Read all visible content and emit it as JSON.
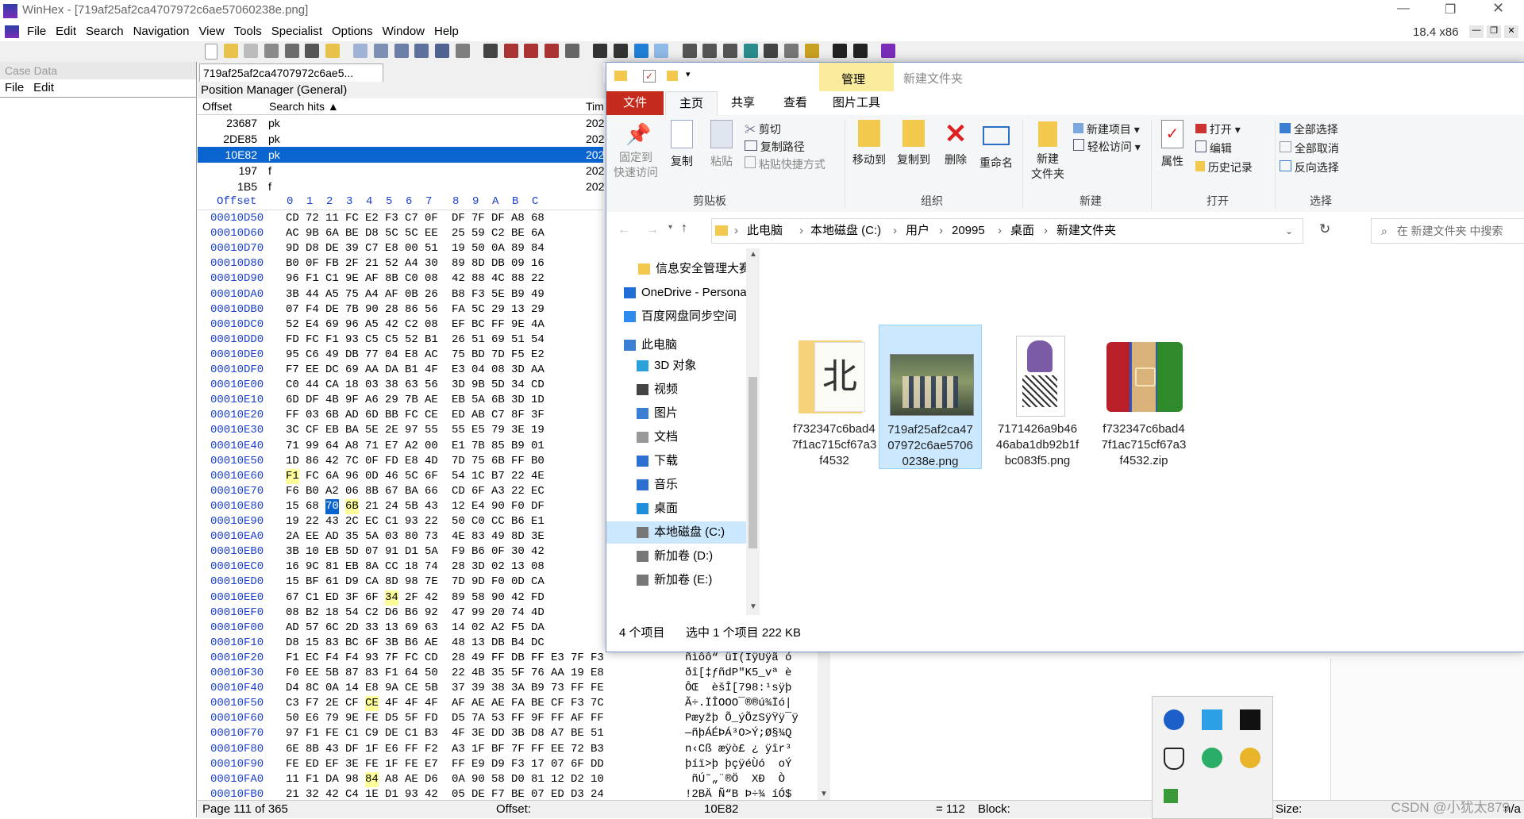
{
  "winhex": {
    "title": "WinHex - [719af25af2ca4707972c6ae57060238e.png]",
    "version": "18.4 x86",
    "menu": [
      "File",
      "Edit",
      "Search",
      "Navigation",
      "View",
      "Tools",
      "Specialist",
      "Options",
      "Window",
      "Help"
    ],
    "case_panel": {
      "title": "Case Data",
      "menu": [
        "File",
        "Edit"
      ]
    },
    "tab_label": "719af25af2ca4707972c6ae5...",
    "position_manager": {
      "title": "Position Manager (General)",
      "columns": [
        "Offset",
        "Search hits ▲",
        "Tim"
      ],
      "rows": [
        {
          "offset": "23687",
          "hit": "pk",
          "time": "202"
        },
        {
          "offset": "2DE85",
          "hit": "pk",
          "time": "202"
        },
        {
          "offset": "10E82",
          "hit": "pk",
          "time": "202"
        },
        {
          "offset": "197",
          "hit": "f",
          "time": "202"
        },
        {
          "offset": "1B5",
          "hit": "f",
          "time": "202"
        }
      ]
    },
    "hex_header": {
      "offset_label": "Offset",
      "cols": [
        "0",
        "1",
        "2",
        "3",
        "4",
        "5",
        "6",
        "7",
        "8",
        "9",
        "A",
        "B",
        "C"
      ]
    },
    "hex_rows": [
      {
        "off": "00010D50",
        "bytes": "CD 72 11 FC E2 F3 C7 0F  DF 7F DF A8 68",
        "text": ""
      },
      {
        "off": "00010D60",
        "bytes": "AC 9B 6A BE D8 5C 5C EE  25 59 C2 BE 6A",
        "text": ""
      },
      {
        "off": "00010D70",
        "bytes": "9D D8 DE 39 C7 E8 00 51  19 50 0A 89 84",
        "text": ""
      },
      {
        "off": "00010D80",
        "bytes": "B0 0F FB 2F 21 52 A4 30  89 8D DB 09 16",
        "text": ""
      },
      {
        "off": "00010D90",
        "bytes": "96 F1 C1 9E AF 8B C0 08  42 88 4C 88 22",
        "text": ""
      },
      {
        "off": "00010DA0",
        "bytes": "3B 44 A5 75 A4 AF 0B 26  B8 F3 5E B9 49",
        "text": ""
      },
      {
        "off": "00010DB0",
        "bytes": "07 F4 DE 7B 90 28 86 56  FA 5C 29 13 29",
        "text": ""
      },
      {
        "off": "00010DC0",
        "bytes": "52 E4 69 96 A5 42 C2 08  EF BC FF 9E 4A",
        "text": ""
      },
      {
        "off": "00010DD0",
        "bytes": "FD FC F1 93 C5 C5 52 B1  26 51 69 51 54",
        "text": ""
      },
      {
        "off": "00010DE0",
        "bytes": "95 C6 49 DB 77 04 E8 AC  75 BD 7D F5 E2",
        "text": ""
      },
      {
        "off": "00010DF0",
        "bytes": "F7 EE DC 69 AA DA B1 4F  E3 04 08 3D AA",
        "text": ""
      },
      {
        "off": "00010E00",
        "bytes": "C0 44 CA 18 03 38 63 56  3D 9B 5D 34 CD",
        "text": ""
      },
      {
        "off": "00010E10",
        "bytes": "6D DF 4B 9F A6 29 7B AE  EB 5A 6B 3D 1D",
        "text": ""
      },
      {
        "off": "00010E20",
        "bytes": "FF 03 6B AD 6D BB FC CE  ED AB C7 8F 3F",
        "text": ""
      },
      {
        "off": "00010E30",
        "bytes": "3C CF EB BA 5E 2E 97 55  55 E5 79 3E 19",
        "text": ""
      },
      {
        "off": "00010E40",
        "bytes": "71 99 64 A8 71 E7 A2 00  E1 7B 85 B9 01",
        "text": ""
      },
      {
        "off": "00010E50",
        "bytes": "1D 86 42 7C 0F FD E8 4D  7D 75 6B FF B0",
        "text": ""
      },
      {
        "off": "00010E60",
        "bytes": "F1 FC 6A 96 0D 46 5C 6F  54 1C B7 22 4E",
        "text": ""
      },
      {
        "off": "00010E70",
        "bytes": "F6 B0 A2 06 8B 67 BA 66  CD 6F A3 22 EC",
        "text": ""
      },
      {
        "off": "00010E80",
        "bytes": "15 68 70 6B 21 24 5B 43  12 E4 90 F0 DF",
        "text": ""
      },
      {
        "off": "00010E90",
        "bytes": "19 22 43 2C EC C1 93 22  50 C0 CC B6 E1",
        "text": ""
      },
      {
        "off": "00010EA0",
        "bytes": "2A EE AD 35 5A 03 80 73  4E 83 49 8D 3E",
        "text": ""
      },
      {
        "off": "00010EB0",
        "bytes": "3B 10 EB 5D 07 91 D1 5A  F9 B6 0F 30 42",
        "text": ""
      },
      {
        "off": "00010EC0",
        "bytes": "16 9C 81 EB 8A CC 18 74  28 3D 02 13 08",
        "text": ""
      },
      {
        "off": "00010ED0",
        "bytes": "15 BF 61 D9 CA 8D 98 7E  7D 9D F0 0D CA",
        "text": ""
      },
      {
        "off": "00010EE0",
        "bytes": "67 C1 ED 3F 6F 34 2F 42  89 58 90 42 FD",
        "text": ""
      },
      {
        "off": "00010EF0",
        "bytes": "08 B2 18 54 C2 D6 B6 92  47 99 20 74 4D",
        "text": ""
      },
      {
        "off": "00010F00",
        "bytes": "AD 57 6C 2D 33 13 69 63  14 02 A2 F5 DA",
        "text": ""
      },
      {
        "off": "00010F10",
        "bytes": "D8 15 83 BC 6F 3B B6 AE  48 13 DB B4 DC",
        "text": ""
      },
      {
        "off": "00010F20",
        "bytes": "F1 EC F4 F4 93 7F FC CD  28 49 FF DB FF E3 7F F3",
        "text": "ñìôô“ üÍ(IÿÛÿã ó"
      },
      {
        "off": "00010F30",
        "bytes": "F0 EE 5B 87 83 F1 64 50  22 4B 35 5F 76 AA 19 E8",
        "text": "ðî[‡ƒñdP\"K5_vª è"
      },
      {
        "off": "00010F40",
        "bytes": "D4 8C 0A 14 E8 9A CE 5B  37 39 38 3A B9 73 FF FE",
        "text": "ÔŒ  èšÎ[798:¹sÿþ"
      },
      {
        "off": "00010F50",
        "bytes": "C3 F7 2E CF CE 4F 4F 4F  AF AE AE FA BE CF F3 7C",
        "text": "Ã÷.ÏÎOOO¯®®ú¾Ïó|"
      },
      {
        "off": "00010F60",
        "bytes": "50 E6 79 9E FE D5 5F FD  D5 7A 53 FF 9F FF AF FF",
        "text": "Pæyžþ Õ_ýÕzSÿŸÿ¯ÿ"
      },
      {
        "off": "00010F70",
        "bytes": "97 F1 FE C1 C9 DE C1 B3  4F 3E DD 3B D8 A7 BE 51",
        "text": "—ñþÁÉÞÁ³O>Ý;Ø§¾Q"
      },
      {
        "off": "00010F80",
        "bytes": "6E 8B 43 DF 1F E6 FF F2  A3 1F BF 7F FF EE 72 B3",
        "text": "n‹Cß æÿò£ ¿ ÿîr³"
      },
      {
        "off": "00010F90",
        "bytes": "FE ED EF 3E FE 1F FE E7  FF E9 D9 F3 17 07 6F DD",
        "text": "þíï>þ þçÿéÙó  oÝ"
      },
      {
        "off": "00010FA0",
        "bytes": "11 F1 DA 98 84 A8 AE D6  0A 90 58 D0 81 12 D2 10",
        "text": " ñÚ˜„¨®Ö  XÐ  Ò "
      },
      {
        "off": "00010FB0",
        "bytes": "21 32 42 C4 1E D1 93 42  05 DE F7 BE 07 ED D3 24",
        "text": "!2BÄ Ñ“B Þ÷¾ íÓ$"
      }
    ],
    "status": {
      "page": "Page 111 of 365",
      "offset_label": "Offset:",
      "offset_value": "10E82",
      "eq": "= 112",
      "block": "Block:",
      "size": "Size:",
      "na": "n/a"
    }
  },
  "explorer": {
    "qa_title": "新建文件夹",
    "contextual_tab": "管理",
    "tabs": [
      "文件",
      "主页",
      "共享",
      "查看",
      "图片工具"
    ],
    "ribbon": {
      "clipboard": {
        "label": "剪贴板",
        "pin": "固定到\n快速访问",
        "copy": "复制",
        "paste": "粘贴",
        "cut": "剪切",
        "copy_path": "复制路径",
        "paste_shortcut": "粘贴快捷方式"
      },
      "organize": {
        "label": "组织",
        "move_to": "移动到",
        "copy_to": "复制到",
        "delete": "删除",
        "rename": "重命名"
      },
      "new": {
        "label": "新建",
        "new_folder": "新建\n文件夹",
        "new_item": "新建项目",
        "easy_access": "轻松访问"
      },
      "open": {
        "label": "打开",
        "properties": "属性",
        "open": "打开",
        "edit": "编辑",
        "history": "历史记录"
      },
      "select": {
        "label": "选择",
        "select_all": "全部选择",
        "select_none": "全部取消",
        "invert": "反向选择"
      }
    },
    "breadcrumb": [
      "此电脑",
      "本地磁盘 (C:)",
      "用户",
      "20995",
      "桌面",
      "新建文件夹"
    ],
    "search_placeholder": "在 新建文件夹 中搜索",
    "nav": [
      {
        "label": "信息安全管理大赛",
        "icon": "folder-icon"
      },
      {
        "label": "OneDrive - Personal",
        "icon": "cloud-icon"
      },
      {
        "label": "百度网盘同步空间",
        "icon": "baidu-icon"
      },
      {
        "label": "此电脑",
        "icon": "pc-icon"
      },
      {
        "label": "3D 对象",
        "icon": "cube-icon"
      },
      {
        "label": "视频",
        "icon": "video-icon"
      },
      {
        "label": "图片",
        "icon": "picture-icon"
      },
      {
        "label": "文档",
        "icon": "document-icon"
      },
      {
        "label": "下载",
        "icon": "download-icon"
      },
      {
        "label": "音乐",
        "icon": "music-icon"
      },
      {
        "label": "桌面",
        "icon": "desktop-icon"
      },
      {
        "label": "本地磁盘 (C:)",
        "icon": "drive-icon"
      },
      {
        "label": "新加卷 (D:)",
        "icon": "drive-icon"
      },
      {
        "label": "新加卷 (E:)",
        "icon": "drive-icon"
      }
    ],
    "files": [
      {
        "name": "f732347c6bad47f1ac715cf67a3f4532",
        "lines": [
          "f732347c6bad4",
          "7f1ac715cf67a3",
          "f4532"
        ],
        "kind": "folder"
      },
      {
        "name": "719af25af2ca4707972c6ae57060238e.png",
        "lines": [
          "719af25af2ca47",
          "07972c6ae5706",
          "0238e.png"
        ],
        "kind": "image-anime"
      },
      {
        "name": "7171426a9b4646aba1db92b1fbc083f5.png",
        "lines": [
          "7171426a9b46",
          "46aba1db92b1f",
          "bc083f5.png"
        ],
        "kind": "image-girl"
      },
      {
        "name": "f732347c6bad47f1ac715cf67a3f4532.zip",
        "lines": [
          "f732347c6bad4",
          "7f1ac715cf67a3",
          "f4532.zip"
        ],
        "kind": "zip"
      }
    ],
    "status": {
      "count": "4 个项目",
      "selected": "选中 1 个项目  222 KB"
    }
  },
  "watermark": "CSDN @小犹太879"
}
